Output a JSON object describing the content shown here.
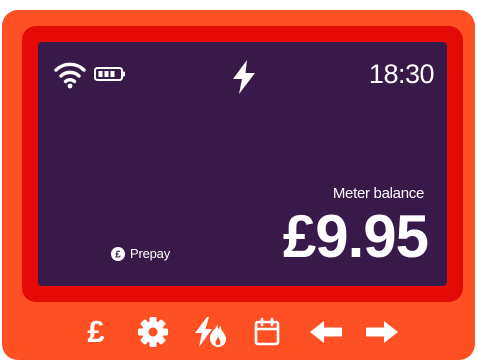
{
  "status_bar": {
    "wifi_icon": "wifi-icon",
    "battery_icon": "battery-icon",
    "center_icon": "lightning-bolt-icon",
    "time": "18:30"
  },
  "balance": {
    "label": "Meter balance",
    "value": "£9.95"
  },
  "mode": {
    "icon": "pound-circle-icon",
    "label": "Prepay"
  },
  "buttons": {
    "pound": {
      "glyph": "£",
      "icon": "pound-icon"
    },
    "settings": {
      "icon": "gear-icon"
    },
    "energy": {
      "icon": "electricity-gas-icon"
    },
    "calendar": {
      "icon": "calendar-icon"
    },
    "left": {
      "icon": "arrow-left-icon"
    },
    "right": {
      "icon": "arrow-right-icon"
    }
  },
  "colors": {
    "casing": "#ff5024",
    "bezel": "#e40a06",
    "screen": "#371a4a",
    "text": "#ffffff"
  }
}
